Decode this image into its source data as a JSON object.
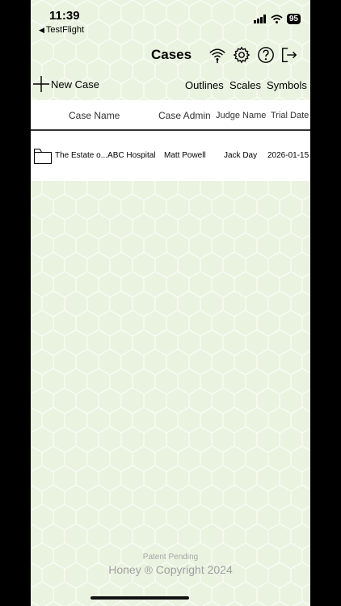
{
  "status_bar": {
    "time": "11:39",
    "back_label": "TestFlight",
    "battery": "95",
    "icons": [
      "signal-bars-icon",
      "wifi-icon",
      "battery-icon"
    ]
  },
  "nav": {
    "title": "Cases",
    "icons": [
      "wifi-broadcast-icon",
      "gear-icon",
      "help-icon",
      "logout-icon"
    ]
  },
  "toolbar": {
    "new_case_label": "New Case",
    "outlines_label": "Outlines",
    "scales_label": "Scales",
    "symbols_label": "Symbols"
  },
  "table": {
    "columns": [
      "Case Name",
      "Case Admin",
      "Judge Name",
      "Trial Date"
    ],
    "rows": [
      {
        "case_name": "The Estate o...ABC Hospital",
        "case_admin": "Matt Powell",
        "judge_name": "Jack Day",
        "trial_date": "2026-01-15"
      }
    ]
  },
  "footer": {
    "patent": "Patent Pending",
    "copyright": "Honey ® Copyright 2024"
  },
  "colors": {
    "background": "#eaf3e0",
    "text": "#000000",
    "footer_text": "#a7a7a7"
  }
}
